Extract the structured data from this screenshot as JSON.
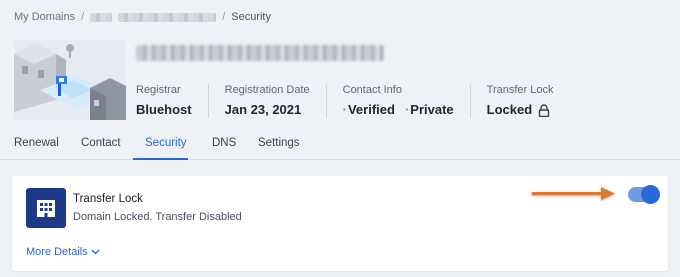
{
  "breadcrumb": {
    "root": "My Domains",
    "separator": "/",
    "current": "Security"
  },
  "meta": {
    "registrar_label": "Registrar",
    "registrar_value": "Bluehost",
    "regdate_label": "Registration Date",
    "regdate_value": "Jan 23, 2021",
    "contact_label": "Contact Info",
    "contact_verified": "Verified",
    "contact_private": "Private",
    "transfer_label": "Transfer Lock",
    "transfer_value": "Locked"
  },
  "tabs": [
    {
      "label": "Renewal"
    },
    {
      "label": "Contact"
    },
    {
      "label": "Security"
    },
    {
      "label": "DNS"
    },
    {
      "label": "Settings"
    }
  ],
  "card": {
    "title": "Transfer Lock",
    "subtitle": "Domain Locked. Transfer Disabled",
    "more": "More Details",
    "toggle_on": true
  },
  "colors": {
    "accent": "#2b66d9",
    "icon_bg": "#1d3a8a",
    "arrow": "#e07a32",
    "verified_dot": "#4caf50"
  }
}
